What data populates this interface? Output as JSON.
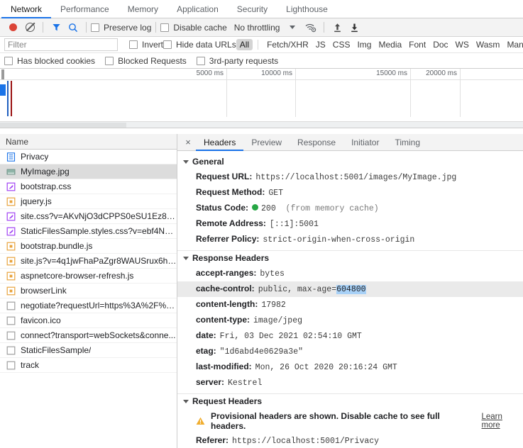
{
  "panel_tabs": [
    {
      "label": "Network",
      "active": true
    },
    {
      "label": "Performance",
      "active": false
    },
    {
      "label": "Memory",
      "active": false
    },
    {
      "label": "Application",
      "active": false
    },
    {
      "label": "Security",
      "active": false
    },
    {
      "label": "Lighthouse",
      "active": false
    }
  ],
  "toolbar": {
    "record_title": "record-button",
    "clear_title": "clear-button",
    "filter_title": "filter-button",
    "search_title": "search-button",
    "preserve_log_label": "Preserve log",
    "disable_cache_label": "Disable cache",
    "throttling_label": "No throttling",
    "import_title": "import-har",
    "export_title": "export-har"
  },
  "filter_bar": {
    "placeholder": "Filter",
    "value": "",
    "invert_label": "Invert",
    "hide_data_urls_label": "Hide data URLs",
    "types": [
      {
        "label": "All",
        "active": true
      },
      {
        "label": "Fetch/XHR",
        "active": false
      },
      {
        "label": "JS",
        "active": false
      },
      {
        "label": "CSS",
        "active": false
      },
      {
        "label": "Img",
        "active": false
      },
      {
        "label": "Media",
        "active": false
      },
      {
        "label": "Font",
        "active": false
      },
      {
        "label": "Doc",
        "active": false
      },
      {
        "label": "WS",
        "active": false
      },
      {
        "label": "Wasm",
        "active": false
      },
      {
        "label": "Manifest",
        "active": false
      }
    ]
  },
  "blocked_bar": {
    "has_blocked_cookies_label": "Has blocked cookies",
    "blocked_requests_label": "Blocked Requests",
    "third_party_label": "3rd-party requests"
  },
  "overview": {
    "ticks": [
      "5000 ms",
      "10000 ms",
      "15000 ms",
      "20000 ms"
    ]
  },
  "request_list": {
    "column_header": "Name",
    "rows": [
      {
        "name": "Privacy",
        "icon": "document-icon",
        "selected": false
      },
      {
        "name": "MyImage.jpg",
        "icon": "image-icon",
        "selected": true
      },
      {
        "name": "bootstrap.css",
        "icon": "stylesheet-icon",
        "selected": false
      },
      {
        "name": "jquery.js",
        "icon": "script-icon",
        "selected": false
      },
      {
        "name": "site.css?v=AKvNjO3dCPPS0eSU1Ez8T2...",
        "icon": "stylesheet-icon",
        "selected": false
      },
      {
        "name": "StaticFilesSample.styles.css?v=ebf4NvV...",
        "icon": "stylesheet-icon",
        "selected": false
      },
      {
        "name": "bootstrap.bundle.js",
        "icon": "script-icon",
        "selected": false
      },
      {
        "name": "site.js?v=4q1jwFhaPaZgr8WAUSrux6hA...",
        "icon": "script-icon",
        "selected": false
      },
      {
        "name": "aspnetcore-browser-refresh.js",
        "icon": "script-icon",
        "selected": false
      },
      {
        "name": "browserLink",
        "icon": "script-icon",
        "selected": false
      },
      {
        "name": "negotiate?requestUrl=https%3A%2F%2...",
        "icon": "generic-icon",
        "selected": false
      },
      {
        "name": "favicon.ico",
        "icon": "generic-icon",
        "selected": false
      },
      {
        "name": "connect?transport=webSockets&conne...",
        "icon": "generic-icon",
        "selected": false
      },
      {
        "name": "StaticFilesSample/",
        "icon": "generic-icon",
        "selected": false
      },
      {
        "name": "track",
        "icon": "generic-icon",
        "selected": false
      }
    ]
  },
  "details": {
    "close_label": "×",
    "tabs": [
      {
        "label": "Headers",
        "active": true
      },
      {
        "label": "Preview",
        "active": false
      },
      {
        "label": "Response",
        "active": false
      },
      {
        "label": "Initiator",
        "active": false
      },
      {
        "label": "Timing",
        "active": false
      }
    ],
    "general": {
      "title": "General",
      "request_url_key": "Request URL:",
      "request_url_value": "https://localhost:5001/images/MyImage.jpg",
      "request_method_key": "Request Method:",
      "request_method_value": "GET",
      "status_code_key": "Status Code:",
      "status_code_value": "200",
      "status_code_note": "(from memory cache)",
      "remote_address_key": "Remote Address:",
      "remote_address_value": "[::1]:5001",
      "referrer_policy_key": "Referrer Policy:",
      "referrer_policy_value": "strict-origin-when-cross-origin"
    },
    "response_headers": {
      "title": "Response Headers",
      "rows": [
        {
          "key": "accept-ranges:",
          "value": "bytes",
          "highlighted": false
        },
        {
          "key": "cache-control:",
          "value_prefix": "public, max-age=",
          "value_selected": "604800",
          "highlighted": true
        },
        {
          "key": "content-length:",
          "value": "17982",
          "highlighted": false
        },
        {
          "key": "content-type:",
          "value": "image/jpeg",
          "highlighted": false
        },
        {
          "key": "date:",
          "value": "Fri, 03 Dec 2021 02:54:10 GMT",
          "highlighted": false
        },
        {
          "key": "etag:",
          "value": "\"1d6abd4e0629a3e\"",
          "highlighted": false
        },
        {
          "key": "last-modified:",
          "value": "Mon, 26 Oct 2020 20:16:24 GMT",
          "highlighted": false
        },
        {
          "key": "server:",
          "value": "Kestrel",
          "highlighted": false
        }
      ]
    },
    "request_headers": {
      "title": "Request Headers",
      "warning_text": "Provisional headers are shown. Disable cache to see full headers.",
      "learn_more_label": "Learn more",
      "referer_key": "Referer:",
      "referer_value": "https://localhost:5001/Privacy"
    }
  },
  "colors": {
    "accent": "#1a73e8",
    "record": "#db4437",
    "status_ok": "#27a745",
    "selection": "#a8d1f7",
    "warning": "#f0ad2e"
  }
}
